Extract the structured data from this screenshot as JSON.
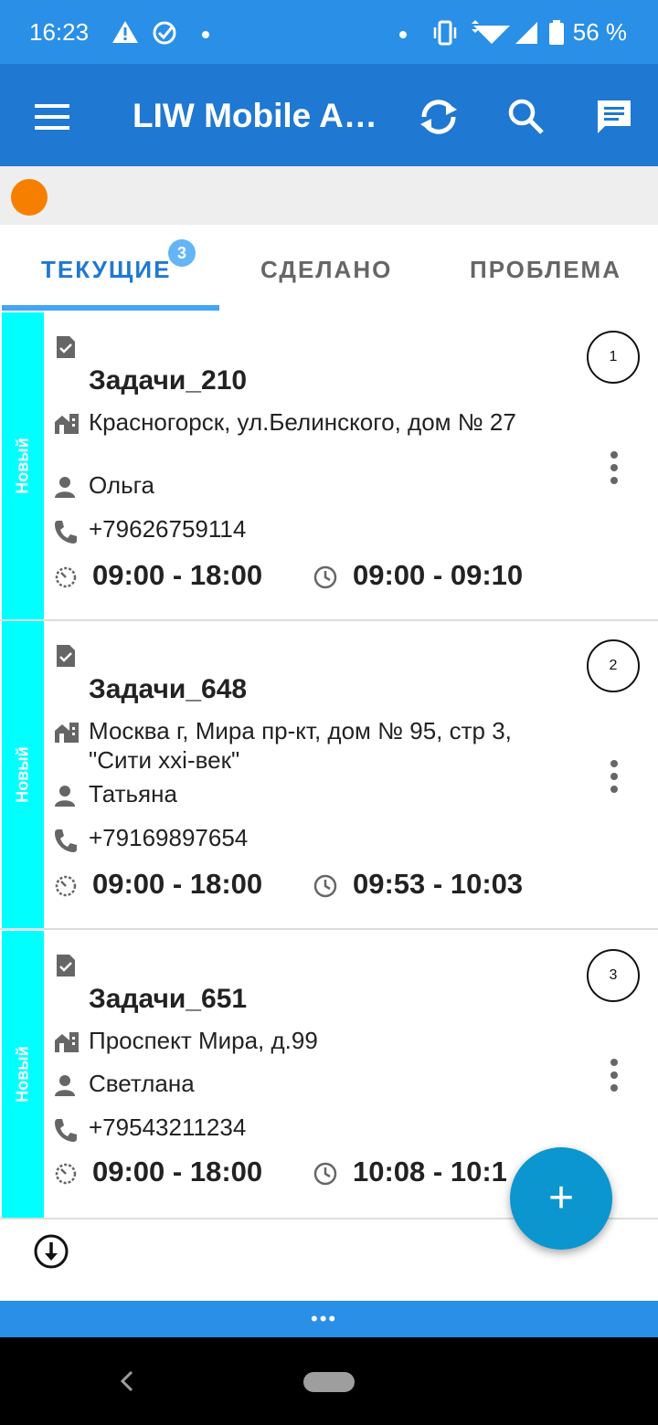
{
  "status_bar": {
    "time": "16:23",
    "battery_percent": "56 %"
  },
  "app_bar": {
    "title": "LIW Mobile A…"
  },
  "tabs": [
    {
      "label": "ТЕКУЩИЕ",
      "badge": "3",
      "active": true
    },
    {
      "label": "СДЕЛАНО"
    },
    {
      "label": "ПРОБЛЕМА"
    }
  ],
  "colors": {
    "status_bar": "#2a8fe6",
    "app_bar": "#1f78d1",
    "status_stripe": "#00ffff",
    "status_dot": "#f77f00",
    "fab": "#0b96cf",
    "tab_active": "#1f78d1"
  },
  "tasks": [
    {
      "status": "Новый",
      "number": "1",
      "title": "Задачи_210",
      "address": "Красногорск, ул.Белинского, дом № 27",
      "contact": "Ольга",
      "phone": "+79626759114",
      "window": "09:00 - 18:00",
      "eta": "09:00 - 09:10"
    },
    {
      "status": "Новый",
      "number": "2",
      "title": "Задачи_648",
      "address": "Москва г, Мира пр-кт, дом № 95, стр 3, \"Сити ххі-век\"",
      "contact": "Татьяна",
      "phone": "+79169897654",
      "window": "09:00 - 18:00",
      "eta": "09:53 - 10:03"
    },
    {
      "status": "Новый",
      "number": "3",
      "title": "Задачи_651",
      "address": "Проспект Мира, д.99",
      "contact": "Светлана",
      "phone": "+79543211234",
      "window": "09:00 - 18:00",
      "eta": "10:08 - 10:1"
    }
  ],
  "fab": {
    "label": "+"
  },
  "bottom_bar": {
    "dots": "•••"
  }
}
